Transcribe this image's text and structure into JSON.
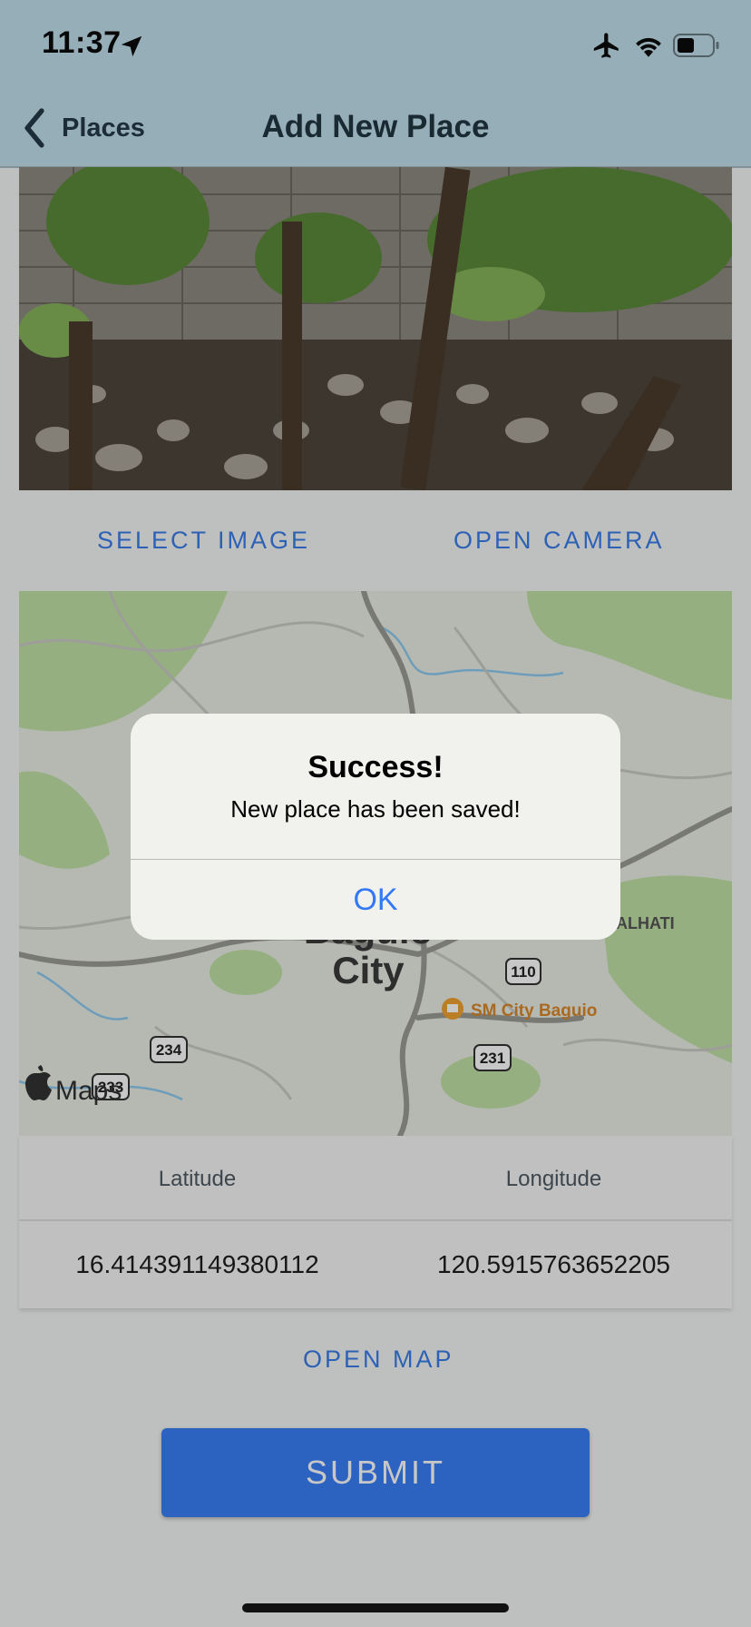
{
  "status_bar": {
    "time": "11:37",
    "location_icon": "location-arrow-icon",
    "airplane_icon": "airplane-icon",
    "wifi_icon": "wifi-icon",
    "battery_icon": "battery-icon",
    "battery_level": 0.4
  },
  "nav": {
    "back_label": "Places",
    "title": "Add New Place"
  },
  "image_actions": {
    "select_image": "SELECT IMAGE",
    "open_camera": "OPEN CAMERA"
  },
  "map": {
    "city_label": "Baguio City",
    "city_line1": "Baguio",
    "city_line2": "City",
    "district_label": "ALHATI",
    "poi_label": "SM City Baguio",
    "road_shields": [
      "110",
      "234",
      "233",
      "231"
    ],
    "attribution": "Maps"
  },
  "coordinates": {
    "latitude_label": "Latitude",
    "longitude_label": "Longitude",
    "latitude_value": "16.414391149380112",
    "longitude_value": "120.5915763652205"
  },
  "open_map_label": "OPEN MAP",
  "submit_label": "SUBMIT",
  "alert": {
    "title": "Success!",
    "message": "New place has been saved!",
    "ok_label": "OK"
  },
  "colors": {
    "nav_bg": "#c0dfec",
    "accent": "#3a7de8",
    "submit_bg": "#3a7ff6",
    "alert_button": "#3478f6"
  }
}
